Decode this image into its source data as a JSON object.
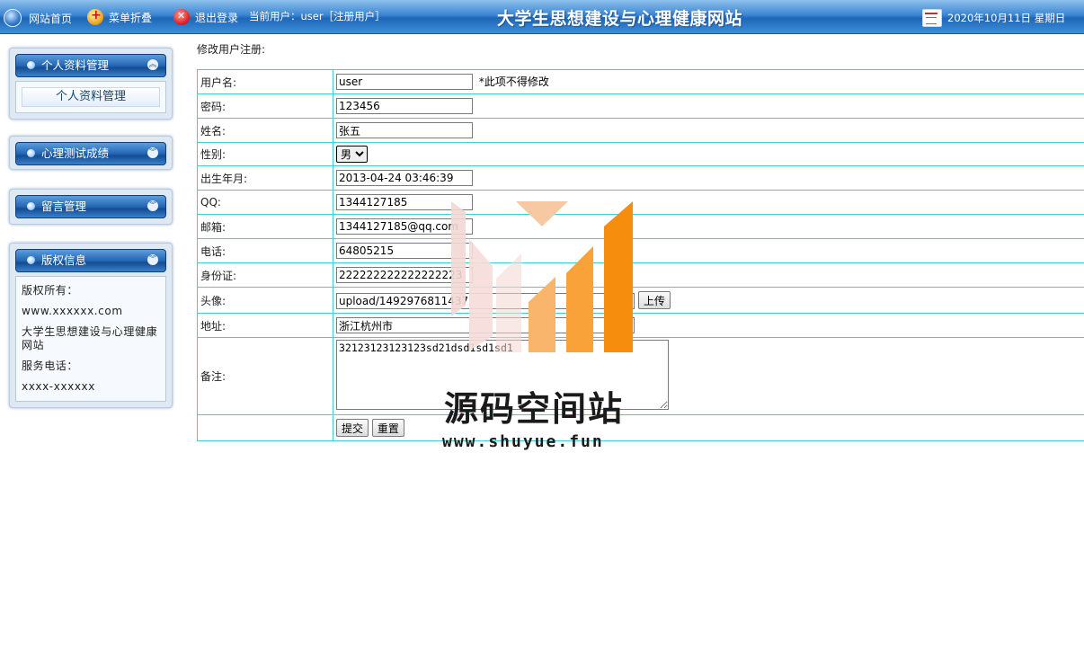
{
  "topbar": {
    "home_label": "网站首页",
    "menu_label": "菜单折叠",
    "logout_label": "退出登录",
    "current_user_label": "当前用户：user［注册用户］",
    "site_title": "大学生思想建设与心理健康网站",
    "date_text": "2020年10月11日 星期日"
  },
  "sidebar": {
    "panels": [
      {
        "title": "个人资料管理",
        "items": [
          "个人资料管理"
        ]
      },
      {
        "title": "心理测试成绩"
      },
      {
        "title": "留言管理"
      },
      {
        "title": "版权信息",
        "copyright": [
          "版权所有：",
          "www.xxxxxx.com",
          "大学生思想建设与心理健康网站",
          "服务电话：",
          "xxxx-xxxxxx"
        ]
      }
    ]
  },
  "form": {
    "title": "修改用户注册:",
    "fields": {
      "username": {
        "label": "用户名:",
        "value": "user",
        "note": "*此项不得修改"
      },
      "password": {
        "label": "密码:",
        "value": "123456"
      },
      "name": {
        "label": "姓名:",
        "value": "张五"
      },
      "gender": {
        "label": "性别:",
        "value": "男"
      },
      "birth": {
        "label": "出生年月:",
        "value": "2013-04-24 03:46:39"
      },
      "qq": {
        "label": "QQ:",
        "value": "1344127185"
      },
      "email": {
        "label": "邮箱:",
        "value": "1344127185@qq.com"
      },
      "phone": {
        "label": "电话:",
        "value": "64805215"
      },
      "idcard": {
        "label": "身份证:",
        "value": "222222222222222223"
      },
      "avatar": {
        "label": "头像:",
        "value": "upload/1492976811437",
        "upload_label": "上传"
      },
      "address": {
        "label": "地址:",
        "value": "浙江杭州市"
      },
      "remark": {
        "label": "备注:",
        "value": "32123123123123sd21dsd1sd1sd1"
      }
    },
    "submit_label": "提交",
    "reset_label": "重置"
  },
  "watermark": {
    "name": "源码空间站",
    "url": "www.shuyue.fun"
  }
}
